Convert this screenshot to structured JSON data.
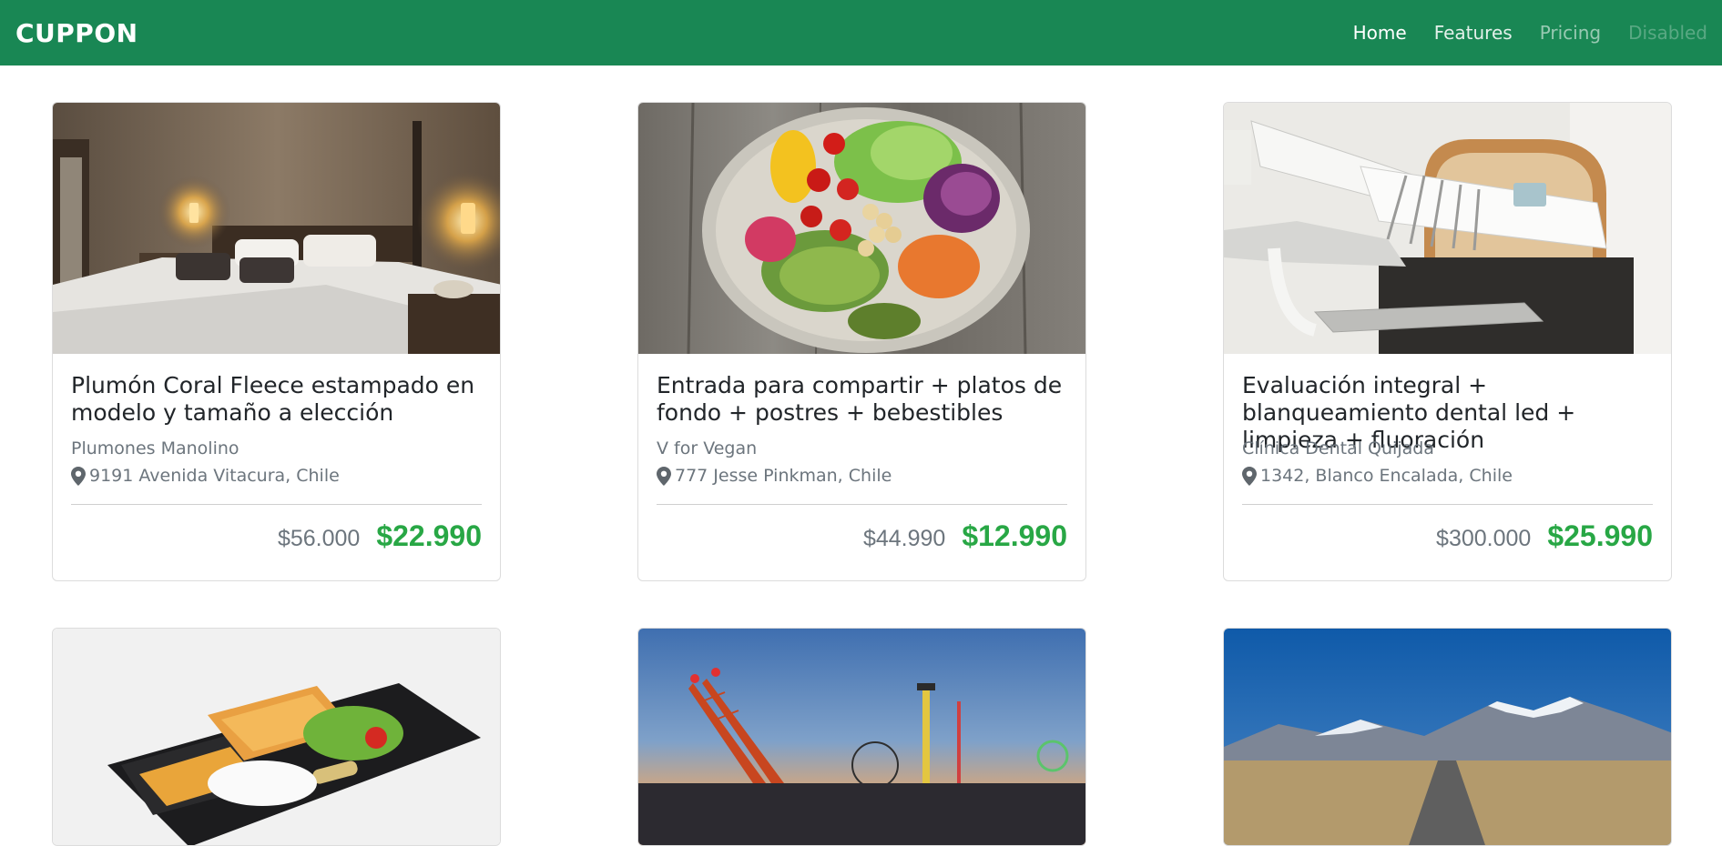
{
  "brand": "CUPPON",
  "nav": [
    {
      "label": "Home"
    },
    {
      "label": "Features"
    },
    {
      "label": "Pricing"
    },
    {
      "label": "Disabled"
    }
  ],
  "colors": {
    "navbar": "#198754",
    "price_accent": "#28a745",
    "muted_text": "#6c757d"
  },
  "deals": [
    {
      "image": "bedroom-photo",
      "title": "Plumón Coral Fleece estampado en modelo y tamaño a elección",
      "merchant": "Plumones Manolino",
      "location": "9191 Avenida Vitacura, Chile",
      "old_price": "$56.000",
      "new_price": "$22.990"
    },
    {
      "image": "vegan-salad-bowl-photo",
      "title": "Entrada para compartir + platos de fondo + postres + bebestibles",
      "merchant": "V for Vegan",
      "location": "777 Jesse Pinkman, Chile",
      "old_price": "$44.990",
      "new_price": "$12.990"
    },
    {
      "image": "dental-chair-photo",
      "title": "Evaluación integral + blanqueamiento dental led + limpieza + fluoración",
      "merchant": "Clínica Dental Quijada",
      "location": "1342, Blanco Encalada, Chile",
      "old_price": "$300.000",
      "new_price": "$25.990"
    }
  ],
  "more_deals": [
    {
      "image": "bento-box-photo"
    },
    {
      "image": "amusement-park-photo"
    },
    {
      "image": "mountain-road-photo"
    }
  ]
}
